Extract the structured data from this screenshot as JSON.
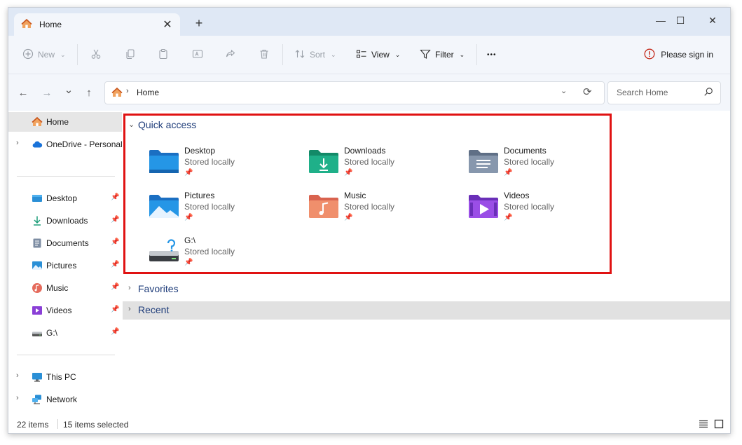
{
  "tab": {
    "title": "Home",
    "close": "✕",
    "new": "+"
  },
  "window_controls": {
    "minimize": "—",
    "maximize": "☐",
    "close": "✕"
  },
  "toolbar": {
    "new_label": "New",
    "sort_label": "Sort",
    "view_label": "View",
    "filter_label": "Filter",
    "more_label": "•••",
    "signin_label": "Please sign in"
  },
  "nav": {
    "back": "←",
    "forward": "→",
    "recent": "⌄",
    "up": "↑"
  },
  "address": {
    "separator": "›",
    "location": "Home"
  },
  "search": {
    "placeholder": "Search Home"
  },
  "sidebar": {
    "home": "Home",
    "onedrive": "OneDrive - Personal",
    "pinned": [
      {
        "label": "Desktop",
        "icon": "desktop-icon"
      },
      {
        "label": "Downloads",
        "icon": "downloads-icon"
      },
      {
        "label": "Documents",
        "icon": "documents-icon"
      },
      {
        "label": "Pictures",
        "icon": "pictures-icon"
      },
      {
        "label": "Music",
        "icon": "music-icon"
      },
      {
        "label": "Videos",
        "icon": "videos-icon"
      },
      {
        "label": "G:\\",
        "icon": "drive-icon"
      }
    ],
    "this_pc": "This PC",
    "network": "Network"
  },
  "main": {
    "quick_access": {
      "header": "Quick access",
      "items": [
        {
          "name": "Desktop",
          "status": "Stored locally",
          "icon": "desktop-folder-icon"
        },
        {
          "name": "Downloads",
          "status": "Stored locally",
          "icon": "downloads-folder-icon"
        },
        {
          "name": "Documents",
          "status": "Stored locally",
          "icon": "documents-folder-icon"
        },
        {
          "name": "Pictures",
          "status": "Stored locally",
          "icon": "pictures-folder-icon"
        },
        {
          "name": "Music",
          "status": "Stored locally",
          "icon": "music-folder-icon"
        },
        {
          "name": "Videos",
          "status": "Stored locally",
          "icon": "videos-folder-icon"
        },
        {
          "name": "G:\\",
          "status": "Stored locally",
          "icon": "drive-icon"
        }
      ]
    },
    "favorites_header": "Favorites",
    "recent_header": "Recent"
  },
  "status": {
    "count": "22 items",
    "selected": "15 items selected"
  },
  "colors": {
    "highlight": "#e01212",
    "accent": "#1f3d7a"
  }
}
